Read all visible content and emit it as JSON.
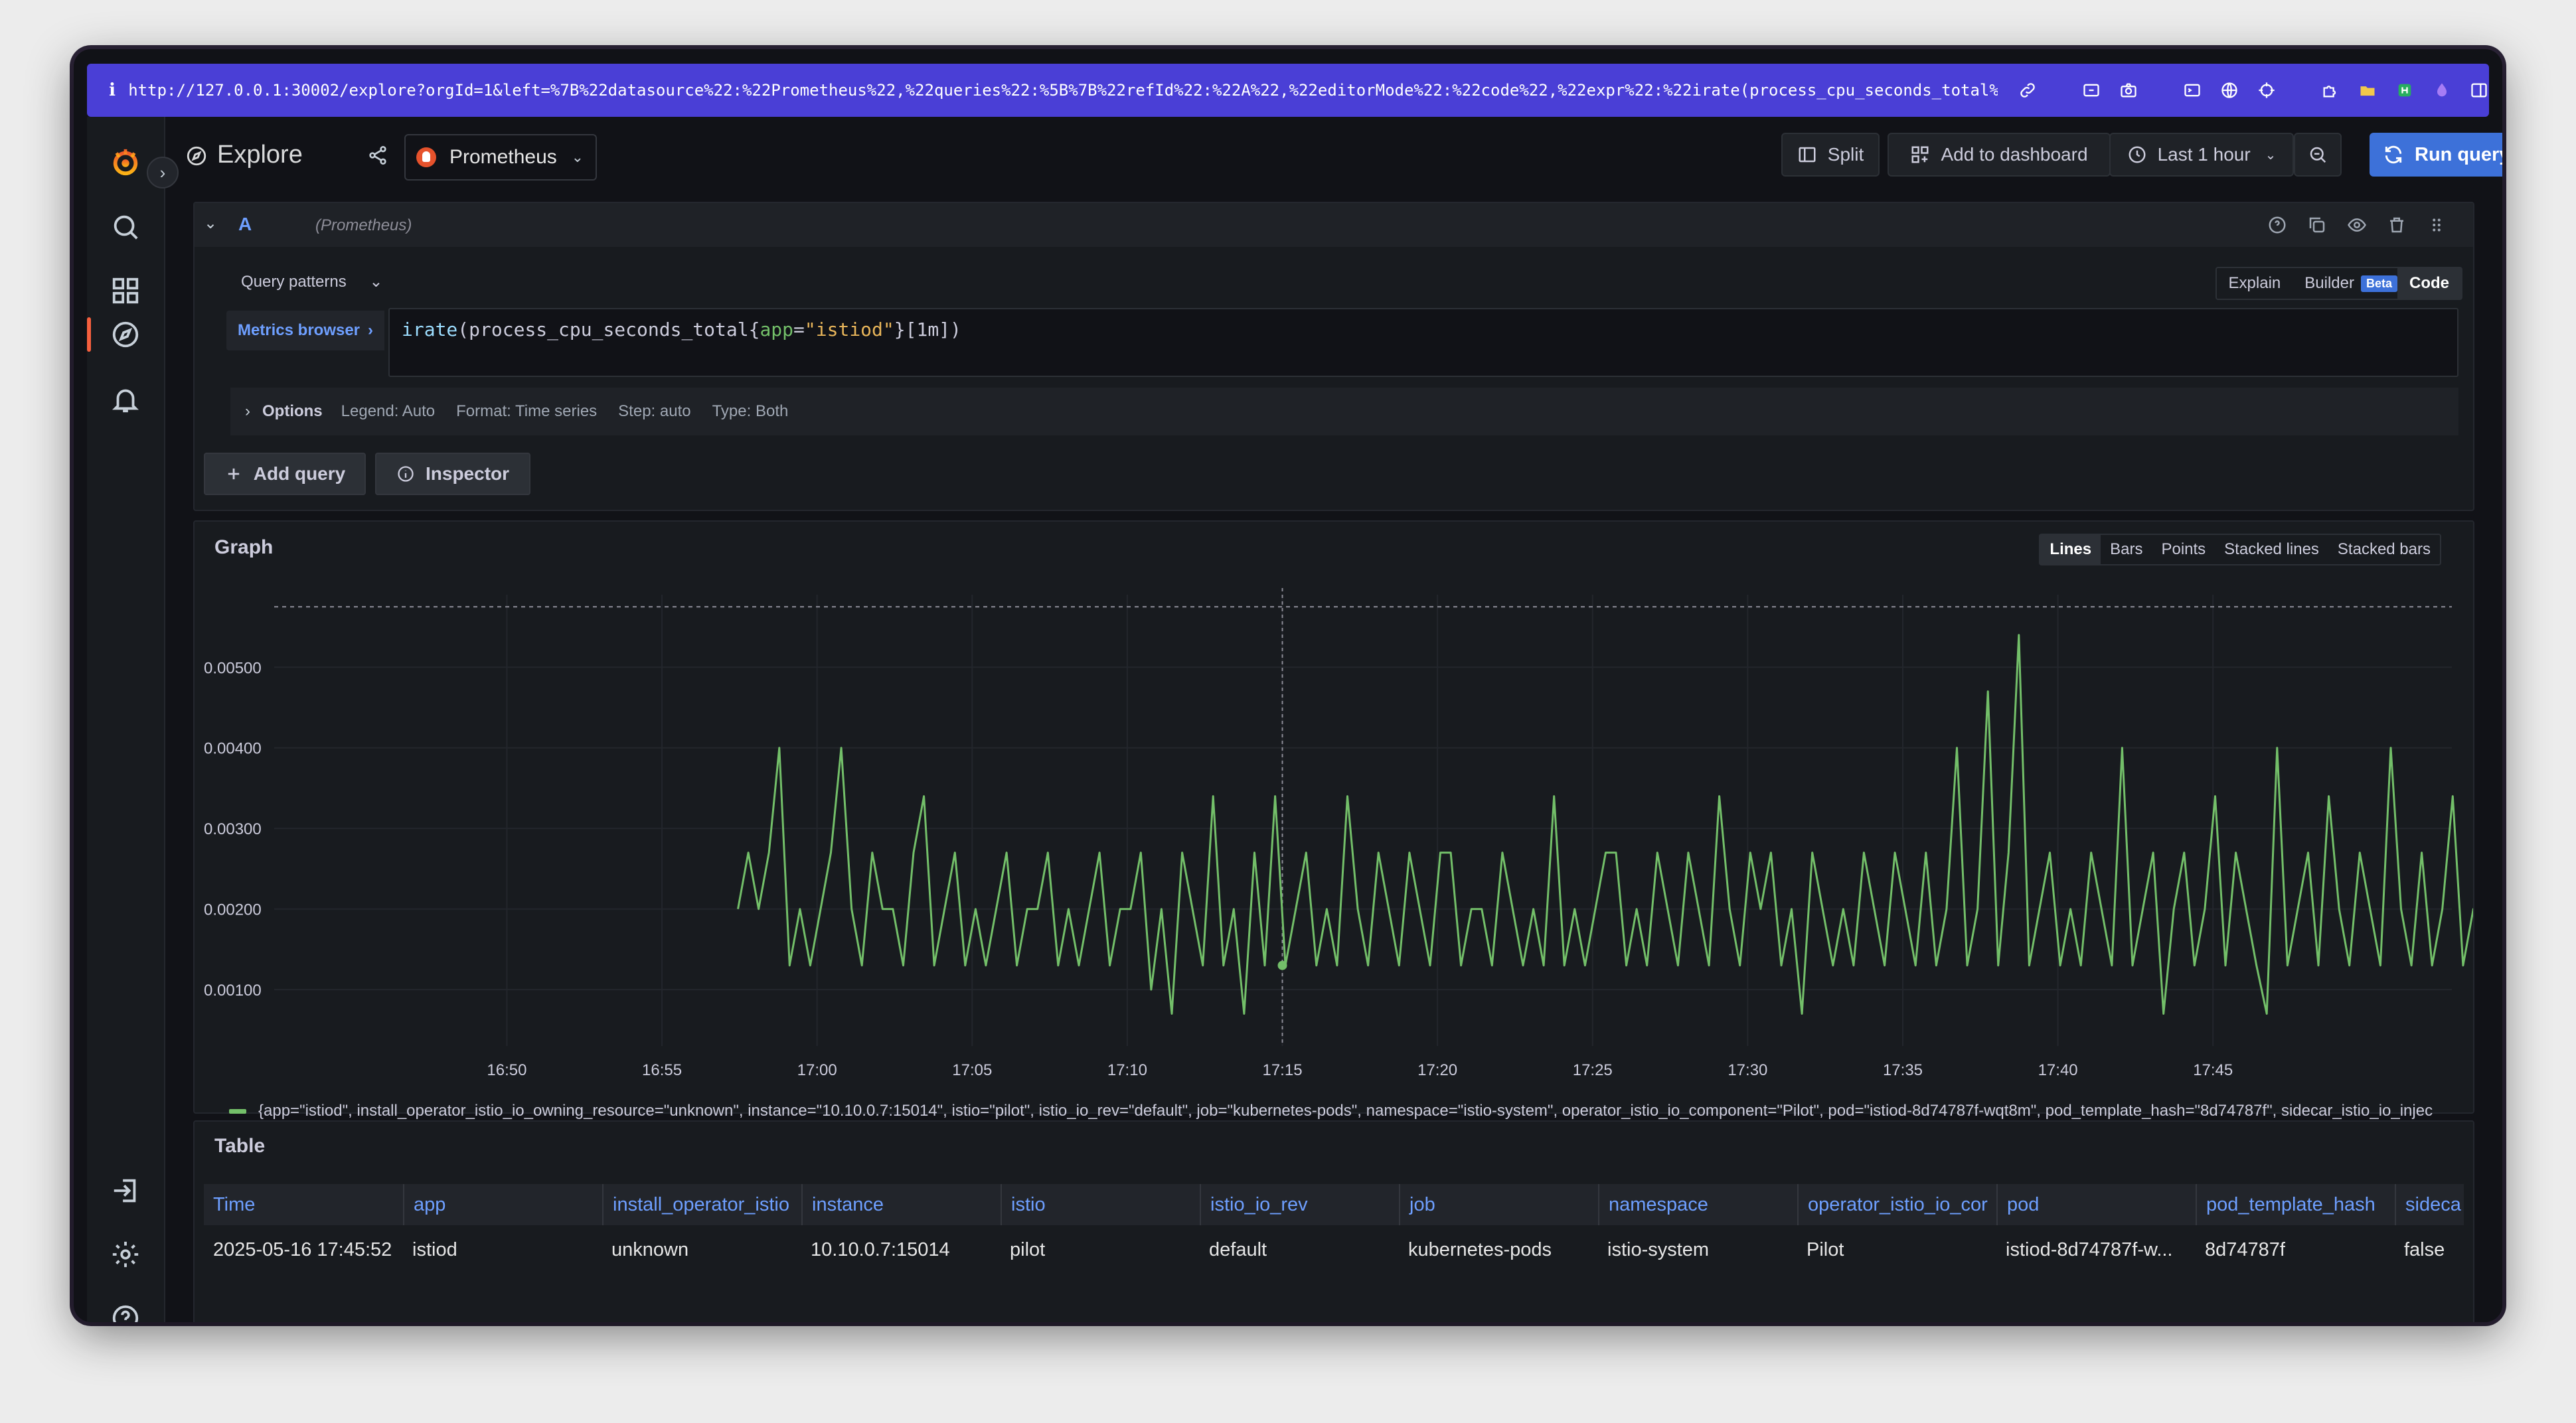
{
  "browser": {
    "info_icon": "i",
    "url": "http://127.0.0.1:30002/explore?orgId=1&left=%7B%22datasource%22:%22Prometheus%22,%22queries%22:%5B%7B%22refId%22:%22A%22,%22editorMode%22:%22code%22,%22expr%22:%22irate(process_cpu_seconds_total%7Bapp%3D%5C%22ist..."
  },
  "header": {
    "title": "Explore",
    "datasource": "Prometheus",
    "split": "Split",
    "add_to_dashboard": "Add to dashboard",
    "time_range": "Last 1 hour",
    "run_query": "Run query"
  },
  "query": {
    "ref_id": "A",
    "datasource_label": "(Prometheus)",
    "query_patterns": "Query patterns",
    "modes": {
      "explain": "Explain",
      "builder": "Builder",
      "beta": "Beta",
      "code": "Code"
    },
    "metrics_browser": "Metrics browser",
    "expr_fn": "irate",
    "expr_metric": "(process_cpu_seconds_total{",
    "expr_label": "app",
    "expr_op": "=",
    "expr_value": "\"istiod\"",
    "expr_tail": "}[1m])",
    "options": {
      "label": "Options",
      "legend": "Legend: Auto",
      "format": "Format: Time series",
      "step": "Step: auto",
      "type": "Type: Both"
    },
    "add_query": "Add query",
    "inspector": "Inspector"
  },
  "graph": {
    "title": "Graph",
    "modes": [
      "Lines",
      "Bars",
      "Points",
      "Stacked lines",
      "Stacked bars"
    ],
    "active_mode": "Lines",
    "legend": "{app=\"istiod\", install_operator_istio_io_owning_resource=\"unknown\", instance=\"10.10.0.7:15014\", istio=\"pilot\", istio_io_rev=\"default\", job=\"kubernetes-pods\", namespace=\"istio-system\", operator_istio_io_component=\"Pilot\", pod=\"istiod-8d74787f-wqt8m\", pod_template_hash=\"8d74787f\", sidecar_istio_io_injec",
    "series_color": "#73bf69"
  },
  "chart_data": {
    "type": "line",
    "x_ticks": [
      "16:50",
      "16:55",
      "17:00",
      "17:05",
      "17:10",
      "17:15",
      "17:20",
      "17:25",
      "17:30",
      "17:35",
      "17:40",
      "17:45"
    ],
    "y_ticks": [
      "0.00100",
      "0.00200",
      "0.00300",
      "0.00400",
      "0.00500"
    ],
    "ylim": [
      0.0003,
      0.0059
    ],
    "x_range_minutes": [
      -7.5,
      62.7
    ],
    "threshold_line": 0.00575,
    "hover_x_minute": 25,
    "series": [
      {
        "color": "#73bf69",
        "step_minutes": 0.333,
        "start_minute": 7.45,
        "values": [
          0.002,
          0.0027,
          0.002,
          0.0027,
          0.004,
          0.0013,
          0.002,
          0.0013,
          0.002,
          0.0027,
          0.004,
          0.002,
          0.0013,
          0.0027,
          0.002,
          0.002,
          0.0013,
          0.0027,
          0.0034,
          0.0013,
          0.002,
          0.0027,
          0.0013,
          0.002,
          0.0013,
          0.002,
          0.0027,
          0.0013,
          0.002,
          0.002,
          0.0027,
          0.0013,
          0.002,
          0.0013,
          0.002,
          0.0027,
          0.0013,
          0.002,
          0.002,
          0.0027,
          0.001,
          0.002,
          0.0007,
          0.0027,
          0.002,
          0.0013,
          0.0034,
          0.0013,
          0.002,
          0.0007,
          0.0027,
          0.0013,
          0.0034,
          0.0013,
          0.002,
          0.0027,
          0.0013,
          0.002,
          0.0013,
          0.0034,
          0.002,
          0.0013,
          0.0027,
          0.002,
          0.0013,
          0.0027,
          0.002,
          0.0013,
          0.0027,
          0.0027,
          0.0013,
          0.002,
          0.002,
          0.0013,
          0.0027,
          0.002,
          0.0013,
          0.002,
          0.0013,
          0.0034,
          0.0013,
          0.002,
          0.0013,
          0.002,
          0.0027,
          0.0027,
          0.0013,
          0.002,
          0.0013,
          0.0027,
          0.002,
          0.0013,
          0.0027,
          0.002,
          0.0013,
          0.0034,
          0.002,
          0.0013,
          0.0027,
          0.002,
          0.0027,
          0.0013,
          0.002,
          0.0007,
          0.0027,
          0.002,
          0.0013,
          0.002,
          0.0013,
          0.0027,
          0.002,
          0.0013,
          0.0027,
          0.002,
          0.0013,
          0.0027,
          0.0013,
          0.002,
          0.004,
          0.0013,
          0.002,
          0.0047,
          0.0013,
          0.0027,
          0.0054,
          0.0013,
          0.002,
          0.0027,
          0.0013,
          0.002,
          0.0013,
          0.0027,
          0.002,
          0.0013,
          0.004,
          0.0013,
          0.002,
          0.0027,
          0.0007,
          0.002,
          0.0027,
          0.0013,
          0.002,
          0.0034,
          0.0013,
          0.0027,
          0.002,
          0.0013,
          0.0007,
          0.004,
          0.0013,
          0.002,
          0.0027,
          0.0013,
          0.0034,
          0.002,
          0.0013,
          0.0027,
          0.002,
          0.0013,
          0.004,
          0.002,
          0.0013,
          0.0027,
          0.0013,
          0.002,
          0.0034,
          0.0013,
          0.002,
          0.002,
          0.0013
        ]
      }
    ]
  },
  "table": {
    "title": "Table",
    "columns": [
      "Time",
      "app",
      "install_operator_istio",
      "instance",
      "istio",
      "istio_io_rev",
      "job",
      "namespace",
      "operator_istio_io_cor",
      "pod",
      "pod_template_hash",
      "sidecar"
    ],
    "rows": [
      [
        "2025-05-16 17:45:52",
        "istiod",
        "unknown",
        "10.10.0.7:15014",
        "pilot",
        "default",
        "kubernetes-pods",
        "istio-system",
        "Pilot",
        "istiod-8d74787f-w...",
        "8d74787f",
        "false"
      ]
    ]
  }
}
